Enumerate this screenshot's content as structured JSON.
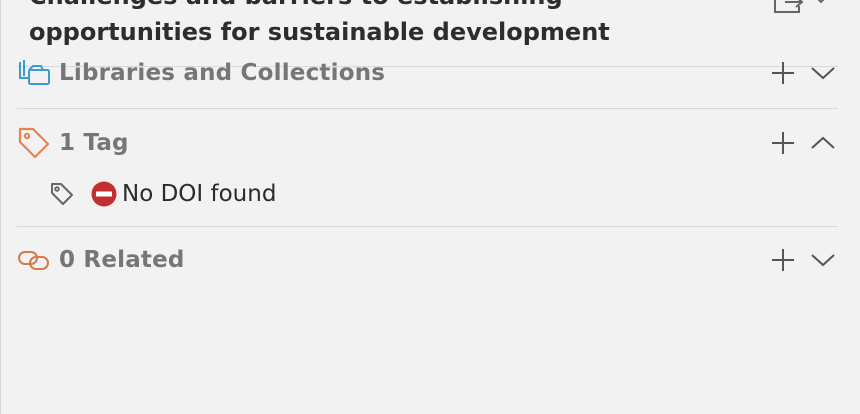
{
  "item": {
    "title_line1": "Challenges and barriers to establishing",
    "title_line2": "opportunities for sustainable development"
  },
  "sections": {
    "libraries": {
      "label": "Libraries and Collections",
      "expanded": false,
      "icon": "libraries-collections-icon"
    },
    "tags": {
      "label": "1 Tag",
      "expanded": true,
      "icon": "tag-icon"
    },
    "related": {
      "label": "0 Related",
      "expanded": false,
      "icon": "related-icon"
    }
  },
  "tags_list": [
    {
      "emoji": "no-entry",
      "text": "No DOI found"
    }
  ],
  "colors": {
    "background": "#f2f2f2",
    "section_label": "#767676",
    "tag_icon_orange": "#e8824f",
    "libraries_icon_blue": "#3a9bd5",
    "related_icon_orange": "#d57a4a",
    "no_entry_red": "#c0312e"
  }
}
